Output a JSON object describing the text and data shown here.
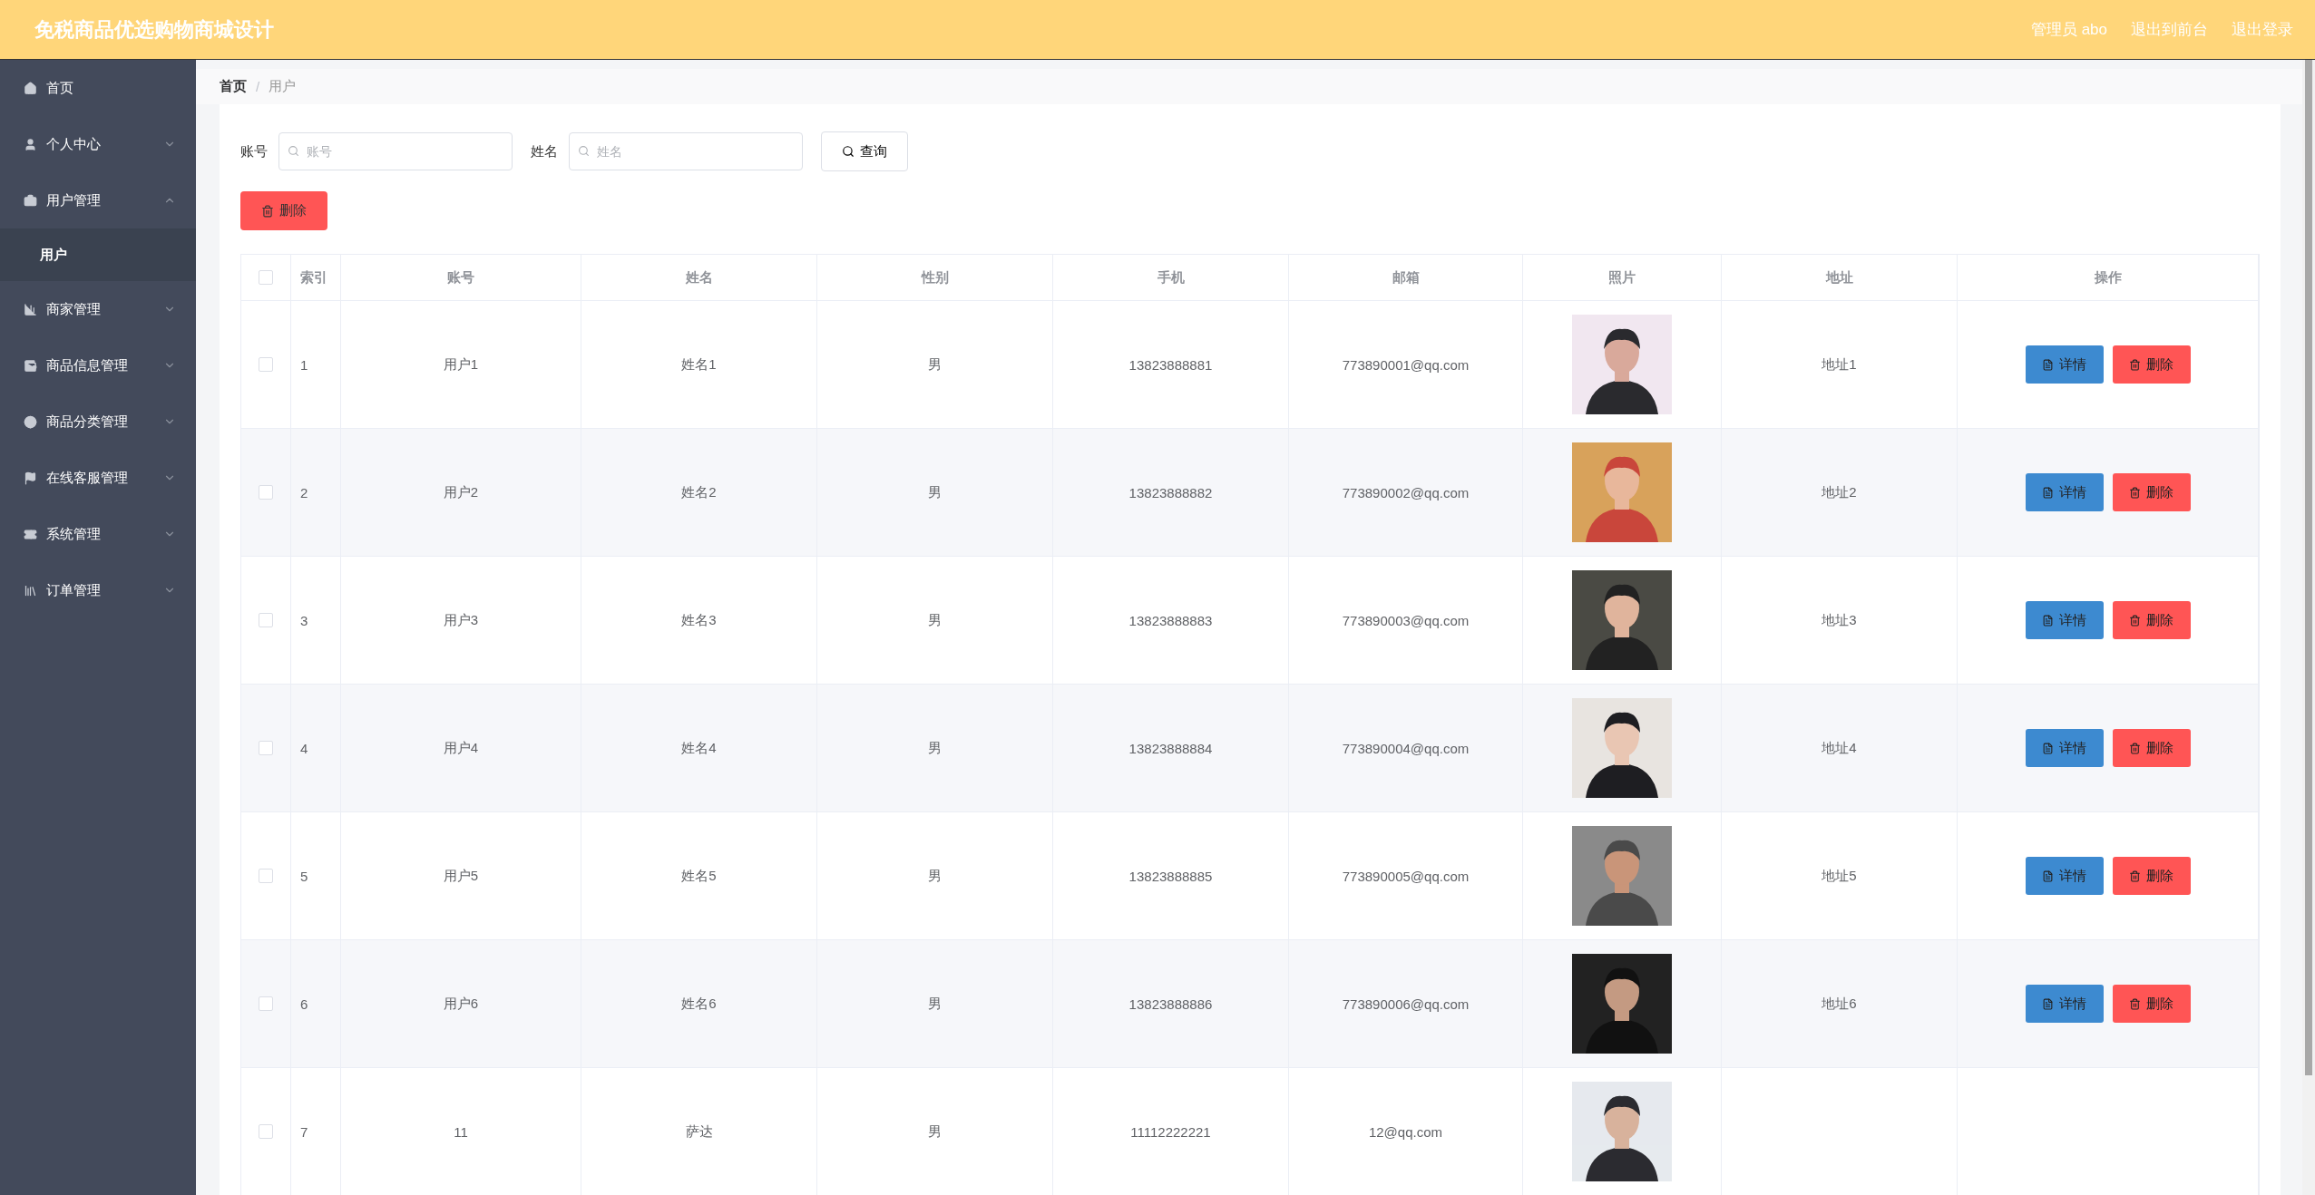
{
  "header": {
    "title": "免税商品优选购物商城设计",
    "links": [
      "管理员 abo",
      "退出到前台",
      "退出登录"
    ]
  },
  "sidebar": {
    "items": [
      {
        "label": "首页"
      },
      {
        "label": "个人中心",
        "expanded": false
      },
      {
        "label": "用户管理",
        "expanded": true,
        "children": [
          {
            "label": "用户",
            "selected": true
          }
        ]
      },
      {
        "label": "商家管理",
        "expanded": false
      },
      {
        "label": "商品信息管理",
        "expanded": false
      },
      {
        "label": "商品分类管理",
        "expanded": false
      },
      {
        "label": "在线客服管理",
        "expanded": false
      },
      {
        "label": "系统管理",
        "expanded": false
      },
      {
        "label": "订单管理",
        "expanded": false
      }
    ]
  },
  "breadcrumb": [
    "首页",
    "用户"
  ],
  "breadcrumb_separator": "/",
  "search": {
    "fields": [
      {
        "label": "账号",
        "placeholder": "账号"
      },
      {
        "label": "姓名",
        "placeholder": "姓名"
      }
    ],
    "button": "查询"
  },
  "delete_button": "删除",
  "table": {
    "all_selected": false,
    "columns": [
      "索引",
      "账号",
      "姓名",
      "性别",
      "手机",
      "邮箱",
      "照片",
      "地址",
      "操作"
    ],
    "rows": [
      {
        "selected": false,
        "index": "1",
        "account": "用户1",
        "name": "姓名1",
        "gender": "男",
        "phone": "13823888881",
        "email": "773890001@qq.com",
        "photo": {
          "kind": "picture"
        },
        "address": "地址1",
        "actions": [
          "详情",
          "删除"
        ]
      },
      {
        "selected": false,
        "index": "2",
        "account": "用户2",
        "name": "姓名2",
        "gender": "男",
        "phone": "13823888882",
        "email": "773890002@qq.com",
        "photo": {
          "kind": "picture"
        },
        "address": "地址2",
        "actions": [
          "详情",
          "删除"
        ]
      },
      {
        "selected": false,
        "index": "3",
        "account": "用户3",
        "name": "姓名3",
        "gender": "男",
        "phone": "13823888883",
        "email": "773890003@qq.com",
        "photo": {
          "kind": "picture"
        },
        "address": "地址3",
        "actions": [
          "详情",
          "删除"
        ]
      },
      {
        "selected": false,
        "index": "4",
        "account": "用户4",
        "name": "姓名4",
        "gender": "男",
        "phone": "13823888884",
        "email": "773890004@qq.com",
        "photo": {
          "kind": "picture"
        },
        "address": "地址4",
        "actions": [
          "详情",
          "删除"
        ]
      },
      {
        "selected": false,
        "index": "5",
        "account": "用户5",
        "name": "姓名5",
        "gender": "男",
        "phone": "13823888885",
        "email": "773890005@qq.com",
        "photo": {
          "kind": "picture"
        },
        "address": "地址5",
        "actions": [
          "详情",
          "删除"
        ]
      },
      {
        "selected": false,
        "index": "6",
        "account": "用户6",
        "name": "姓名6",
        "gender": "男",
        "phone": "13823888886",
        "email": "773890006@qq.com",
        "photo": {
          "kind": "picture"
        },
        "address": "地址6",
        "actions": [
          "详情",
          "删除"
        ]
      },
      {
        "selected": false,
        "index": "7",
        "account": "11",
        "name": "萨达",
        "gender": "男",
        "phone": "11112222221",
        "email": "12@qq.com",
        "photo": {
          "kind": "picture"
        }
      }
    ]
  }
}
